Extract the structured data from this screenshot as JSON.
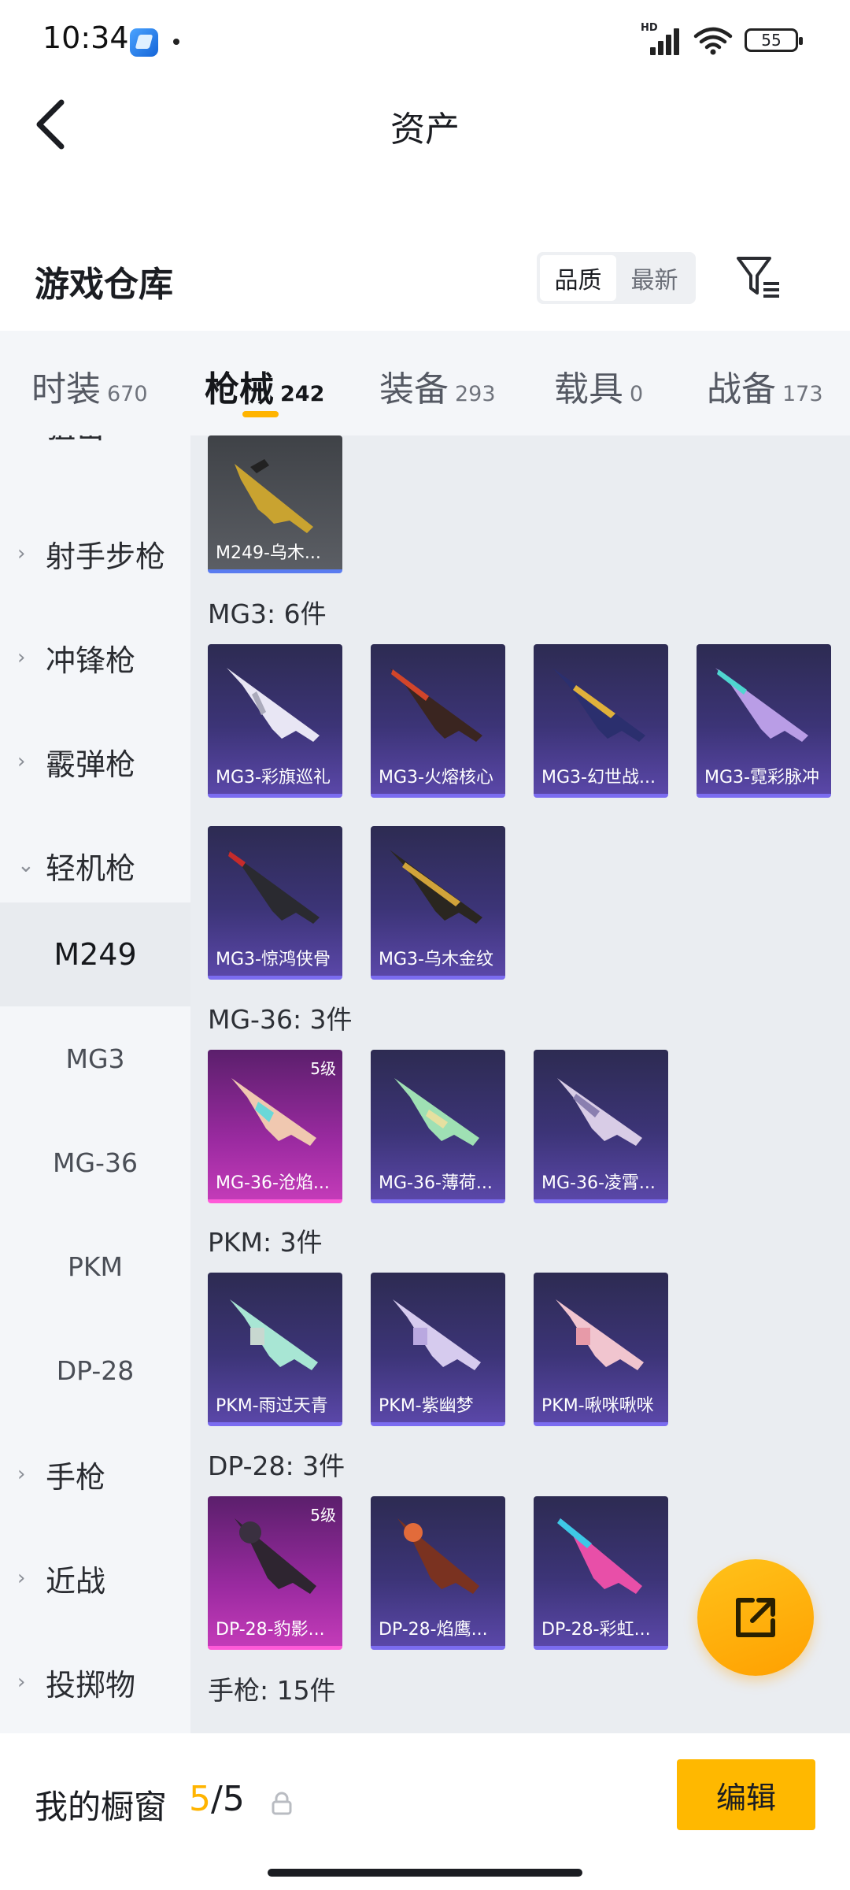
{
  "status_bar": {
    "time": "10:34",
    "network": "HD",
    "battery": "55"
  },
  "header": {
    "title": "资产"
  },
  "warehouse": {
    "title": "游戏仓库",
    "sort_options": [
      "品质",
      "最新"
    ],
    "active_sort": "品质"
  },
  "tabs": [
    {
      "name": "时装",
      "count": "670"
    },
    {
      "name": "枪械",
      "count": "242",
      "active": true
    },
    {
      "name": "装备",
      "count": "293"
    },
    {
      "name": "载具",
      "count": "0"
    },
    {
      "name": "战备",
      "count": "173"
    }
  ],
  "sidebar": {
    "items": [
      {
        "label": "射手步枪"
      },
      {
        "label": "冲锋枪"
      },
      {
        "label": "霰弹枪"
      },
      {
        "label": "轻机枪"
      },
      {
        "label": "M249"
      },
      {
        "label": "MG3"
      },
      {
        "label": "MG-36"
      },
      {
        "label": "PKM"
      },
      {
        "label": "DP-28"
      },
      {
        "label": "手枪"
      },
      {
        "label": "近战"
      },
      {
        "label": "投掷物"
      }
    ],
    "partial_top": "狙击"
  },
  "content": {
    "m249_items": [
      {
        "name": "M249-乌木..."
      }
    ],
    "groups": [
      {
        "title": "MG3: 6件",
        "items": [
          "MG3-彩旗巡礼",
          "MG3-火熔核心",
          "MG3-幻世战...",
          "MG3-霓彩脉冲",
          "MG3-惊鸿侠骨",
          "MG3-乌木金纹"
        ]
      },
      {
        "title": "MG-36: 3件",
        "items": [
          "MG-36-沧焰...",
          "MG-36-薄荷...",
          "MG-36-凌霄..."
        ],
        "level": "5级"
      },
      {
        "title": "PKM: 3件",
        "items": [
          "PKM-雨过天青",
          "PKM-紫幽梦",
          "PKM-啾咪啾咪"
        ]
      },
      {
        "title": "DP-28: 3件",
        "items": [
          "DP-28-豹影...",
          "DP-28-焰鹰...",
          "DP-28-彩虹..."
        ],
        "level": "5级"
      },
      {
        "title": "手枪: 15件"
      }
    ]
  },
  "bottom": {
    "showcase_label": "我的橱窗",
    "current": "5",
    "total": "/5",
    "edit_label": "编辑"
  },
  "colors": {
    "accent": "#ffb400",
    "card_purple": "#3c3477",
    "card_pink": "#9a2aa0"
  }
}
